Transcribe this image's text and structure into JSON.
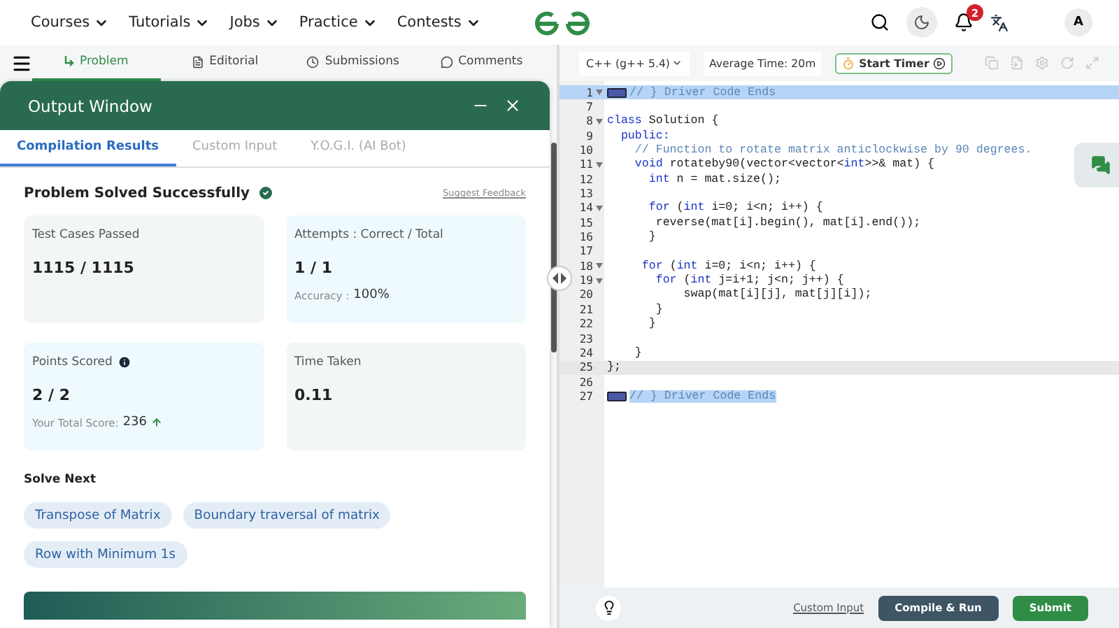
{
  "nav": {
    "menus": [
      "Courses",
      "Tutorials",
      "Jobs",
      "Practice",
      "Contests"
    ],
    "notifications": "2",
    "avatar": "A"
  },
  "problem_tabs": [
    {
      "label": "Problem",
      "selected": true
    },
    {
      "label": "Editorial",
      "selected": false
    },
    {
      "label": "Submissions",
      "selected": false
    },
    {
      "label": "Comments",
      "selected": false
    }
  ],
  "output_window": {
    "title": "Output Window",
    "tabs": [
      {
        "label": "Compilation Results",
        "selected": true
      },
      {
        "label": "Custom Input",
        "selected": false
      },
      {
        "label": "Y.O.G.I. (AI Bot)",
        "selected": false
      }
    ],
    "status": "Problem Solved Successfully",
    "feedback": "Suggest Feedback",
    "cards": [
      {
        "label": "Test Cases Passed",
        "value": "1115 / 1115",
        "color": "#f2f6f5",
        "info": false
      },
      {
        "label": "Attempts : Correct / Total",
        "value": "1 / 1",
        "sub_label": "Accuracy :",
        "sub_value": "100%",
        "color": "#eefafd",
        "info": false
      },
      {
        "label": "Points Scored",
        "value": "2 / 2",
        "sub_label": "Your Total Score:",
        "sub_value": "236",
        "rising": true,
        "color": "#eefafd",
        "info": true
      },
      {
        "label": "Time Taken",
        "value": "0.11",
        "color": "#f2f6f5",
        "info": false
      }
    ],
    "solve_next": {
      "title": "Solve Next",
      "items": [
        "Transpose of Matrix",
        "Boundary traversal of matrix",
        "Row with Minimum 1s"
      ]
    }
  },
  "editor": {
    "language": "C++ (g++ 5.4)",
    "average_time": "Average Time: 20m",
    "timer": "Start Timer",
    "lines": [
      {
        "number": "1",
        "fold": true,
        "selected": true,
        "marker": true,
        "code": [
          {
            "t": "// } Driver Code Ends",
            "kind": "comment"
          }
        ]
      },
      {
        "number": "7",
        "fold": false
      },
      {
        "number": "8",
        "fold": true,
        "code": [
          {
            "t": "class",
            "kind": "keyword"
          },
          {
            "t": " Solution {",
            "kind": "plain"
          }
        ]
      },
      {
        "number": "9",
        "fold": false,
        "code": [
          {
            "t": "  public:",
            "kind": "keyword"
          }
        ]
      },
      {
        "number": "10",
        "fold": false,
        "code": [
          {
            "t": "    // Function to rotate matrix anticlockwise by 90 degrees.",
            "kind": "comment"
          }
        ]
      },
      {
        "number": "11",
        "fold": true,
        "code": [
          {
            "t": "    void",
            "kind": "keyword"
          },
          {
            "t": " rotateby90(vector<vector<",
            "kind": "plain"
          },
          {
            "t": "int",
            "kind": "keyword"
          },
          {
            "t": ">>& mat) {",
            "kind": "plain"
          }
        ]
      },
      {
        "number": "12",
        "fold": false,
        "code": [
          {
            "t": "      int",
            "kind": "keyword"
          },
          {
            "t": " n = mat.size();",
            "kind": "plain"
          }
        ]
      },
      {
        "number": "13",
        "fold": false
      },
      {
        "number": "14",
        "fold": true,
        "code": [
          {
            "t": "      for",
            "kind": "keyword"
          },
          {
            "t": " (",
            "kind": "plain"
          },
          {
            "t": "int",
            "kind": "keyword"
          },
          {
            "t": " i=0; i<n; i++) {",
            "kind": "plain"
          }
        ]
      },
      {
        "number": "15",
        "fold": false,
        "code": [
          {
            "t": "       reverse(mat[i].begin(), mat[i].end());",
            "kind": "plain"
          }
        ]
      },
      {
        "number": "16",
        "fold": false,
        "code": [
          {
            "t": "      }",
            "kind": "plain"
          }
        ]
      },
      {
        "number": "17",
        "fold": false
      },
      {
        "number": "18",
        "fold": true,
        "code": [
          {
            "t": "     for",
            "kind": "keyword"
          },
          {
            "t": " (",
            "kind": "plain"
          },
          {
            "t": "int",
            "kind": "keyword"
          },
          {
            "t": " i=0; i<n; i++) {",
            "kind": "plain"
          }
        ]
      },
      {
        "number": "19",
        "fold": true,
        "code": [
          {
            "t": "       for",
            "kind": "keyword"
          },
          {
            "t": " (",
            "kind": "plain"
          },
          {
            "t": "int",
            "kind": "keyword"
          },
          {
            "t": " j=i+1; j<n; j++) {",
            "kind": "plain"
          }
        ]
      },
      {
        "number": "20",
        "fold": false,
        "code": [
          {
            "t": "           swap(mat[i][j], mat[j][i]);",
            "kind": "plain"
          }
        ]
      },
      {
        "number": "21",
        "fold": false,
        "code": [
          {
            "t": "       }",
            "kind": "plain"
          }
        ]
      },
      {
        "number": "22",
        "fold": false,
        "code": [
          {
            "t": "      }",
            "kind": "plain"
          }
        ]
      },
      {
        "number": "23",
        "fold": false
      },
      {
        "number": "24",
        "fold": false,
        "code": [
          {
            "t": "    }",
            "kind": "plain"
          }
        ]
      },
      {
        "number": "25",
        "fold": false,
        "current": true,
        "code": [
          {
            "t": "};",
            "kind": "plain"
          }
        ]
      },
      {
        "number": "26",
        "fold": false
      },
      {
        "number": "27",
        "fold": false,
        "marker": true,
        "text_selected": true,
        "code": [
          {
            "t": "// } Driver Code Ends",
            "kind": "comment"
          }
        ]
      }
    ],
    "custom_input": "Custom Input",
    "compile": "Compile & Run",
    "submit": "Submit"
  }
}
